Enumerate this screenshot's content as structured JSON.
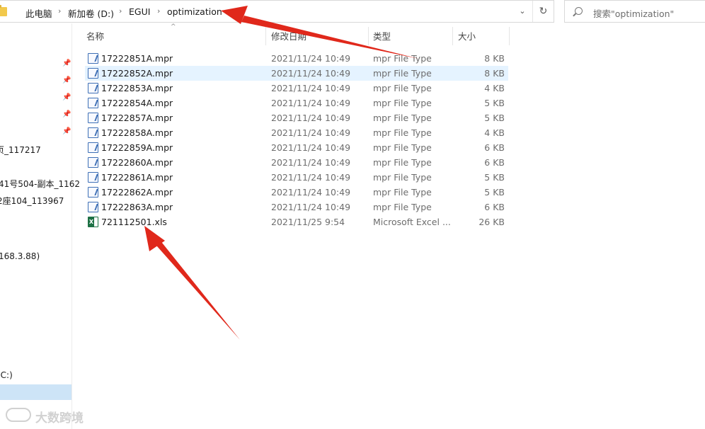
{
  "breadcrumb": {
    "items": [
      "此电脑",
      "新加卷 (D:)",
      "EGUI",
      "optimization"
    ]
  },
  "search": {
    "placeholder": "搜索\"optimization\""
  },
  "nav": {
    "items": [
      "页_117217",
      "41号504-副本_1162",
      "2座104_113967",
      "168.3.88)",
      "(C:)"
    ]
  },
  "columns": {
    "name": "名称",
    "date": "修改日期",
    "type": "类型",
    "size": "大小"
  },
  "files": [
    {
      "name": "17222851A.mpr",
      "date": "2021/11/24 10:49",
      "type": "mpr File Type",
      "size": "8 KB",
      "icon": "mpr-file-icon"
    },
    {
      "name": "17222852A.mpr",
      "date": "2021/11/24 10:49",
      "type": "mpr File Type",
      "size": "8 KB",
      "icon": "mpr-file-icon"
    },
    {
      "name": "17222853A.mpr",
      "date": "2021/11/24 10:49",
      "type": "mpr File Type",
      "size": "4 KB",
      "icon": "mpr-file-icon"
    },
    {
      "name": "17222854A.mpr",
      "date": "2021/11/24 10:49",
      "type": "mpr File Type",
      "size": "5 KB",
      "icon": "mpr-file-icon"
    },
    {
      "name": "17222857A.mpr",
      "date": "2021/11/24 10:49",
      "type": "mpr File Type",
      "size": "5 KB",
      "icon": "mpr-file-icon"
    },
    {
      "name": "17222858A.mpr",
      "date": "2021/11/24 10:49",
      "type": "mpr File Type",
      "size": "4 KB",
      "icon": "mpr-file-icon"
    },
    {
      "name": "17222859A.mpr",
      "date": "2021/11/24 10:49",
      "type": "mpr File Type",
      "size": "6 KB",
      "icon": "mpr-file-icon"
    },
    {
      "name": "17222860A.mpr",
      "date": "2021/11/24 10:49",
      "type": "mpr File Type",
      "size": "6 KB",
      "icon": "mpr-file-icon"
    },
    {
      "name": "17222861A.mpr",
      "date": "2021/11/24 10:49",
      "type": "mpr File Type",
      "size": "5 KB",
      "icon": "mpr-file-icon"
    },
    {
      "name": "17222862A.mpr",
      "date": "2021/11/24 10:49",
      "type": "mpr File Type",
      "size": "5 KB",
      "icon": "mpr-file-icon"
    },
    {
      "name": "17222863A.mpr",
      "date": "2021/11/24 10:49",
      "type": "mpr File Type",
      "size": "6 KB",
      "icon": "mpr-file-icon"
    },
    {
      "name": "721112501.xls",
      "date": "2021/11/25 9:54",
      "type": "Microsoft Excel ...",
      "size": "26 KB",
      "icon": "excel-file-icon"
    }
  ],
  "watermark": {
    "text": "大数跨境"
  },
  "colors": {
    "annotation_arrow": "#e0281b",
    "row_hover": "#e5f3ff",
    "nav_selected": "#cde4f7"
  }
}
